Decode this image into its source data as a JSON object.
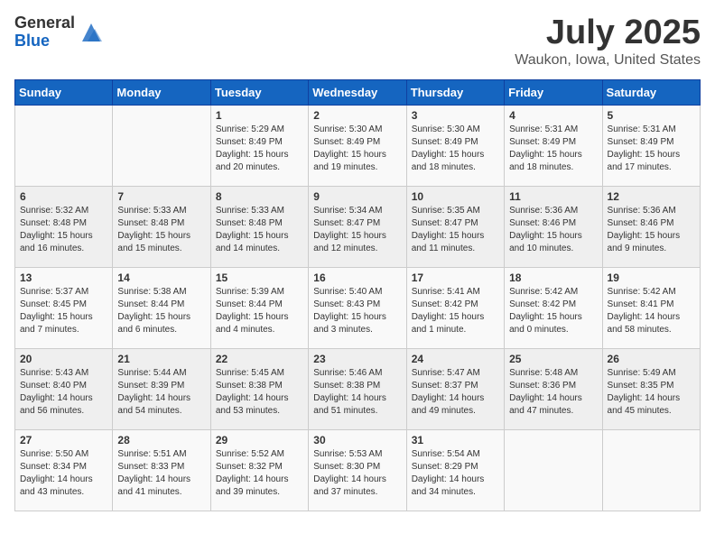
{
  "header": {
    "logo_general": "General",
    "logo_blue": "Blue",
    "month": "July 2025",
    "location": "Waukon, Iowa, United States"
  },
  "days_of_week": [
    "Sunday",
    "Monday",
    "Tuesday",
    "Wednesday",
    "Thursday",
    "Friday",
    "Saturday"
  ],
  "weeks": [
    [
      {
        "day": "",
        "content": ""
      },
      {
        "day": "",
        "content": ""
      },
      {
        "day": "1",
        "content": "Sunrise: 5:29 AM\nSunset: 8:49 PM\nDaylight: 15 hours and 20 minutes."
      },
      {
        "day": "2",
        "content": "Sunrise: 5:30 AM\nSunset: 8:49 PM\nDaylight: 15 hours and 19 minutes."
      },
      {
        "day": "3",
        "content": "Sunrise: 5:30 AM\nSunset: 8:49 PM\nDaylight: 15 hours and 18 minutes."
      },
      {
        "day": "4",
        "content": "Sunrise: 5:31 AM\nSunset: 8:49 PM\nDaylight: 15 hours and 18 minutes."
      },
      {
        "day": "5",
        "content": "Sunrise: 5:31 AM\nSunset: 8:49 PM\nDaylight: 15 hours and 17 minutes."
      }
    ],
    [
      {
        "day": "6",
        "content": "Sunrise: 5:32 AM\nSunset: 8:48 PM\nDaylight: 15 hours and 16 minutes."
      },
      {
        "day": "7",
        "content": "Sunrise: 5:33 AM\nSunset: 8:48 PM\nDaylight: 15 hours and 15 minutes."
      },
      {
        "day": "8",
        "content": "Sunrise: 5:33 AM\nSunset: 8:48 PM\nDaylight: 15 hours and 14 minutes."
      },
      {
        "day": "9",
        "content": "Sunrise: 5:34 AM\nSunset: 8:47 PM\nDaylight: 15 hours and 12 minutes."
      },
      {
        "day": "10",
        "content": "Sunrise: 5:35 AM\nSunset: 8:47 PM\nDaylight: 15 hours and 11 minutes."
      },
      {
        "day": "11",
        "content": "Sunrise: 5:36 AM\nSunset: 8:46 PM\nDaylight: 15 hours and 10 minutes."
      },
      {
        "day": "12",
        "content": "Sunrise: 5:36 AM\nSunset: 8:46 PM\nDaylight: 15 hours and 9 minutes."
      }
    ],
    [
      {
        "day": "13",
        "content": "Sunrise: 5:37 AM\nSunset: 8:45 PM\nDaylight: 15 hours and 7 minutes."
      },
      {
        "day": "14",
        "content": "Sunrise: 5:38 AM\nSunset: 8:44 PM\nDaylight: 15 hours and 6 minutes."
      },
      {
        "day": "15",
        "content": "Sunrise: 5:39 AM\nSunset: 8:44 PM\nDaylight: 15 hours and 4 minutes."
      },
      {
        "day": "16",
        "content": "Sunrise: 5:40 AM\nSunset: 8:43 PM\nDaylight: 15 hours and 3 minutes."
      },
      {
        "day": "17",
        "content": "Sunrise: 5:41 AM\nSunset: 8:42 PM\nDaylight: 15 hours and 1 minute."
      },
      {
        "day": "18",
        "content": "Sunrise: 5:42 AM\nSunset: 8:42 PM\nDaylight: 15 hours and 0 minutes."
      },
      {
        "day": "19",
        "content": "Sunrise: 5:42 AM\nSunset: 8:41 PM\nDaylight: 14 hours and 58 minutes."
      }
    ],
    [
      {
        "day": "20",
        "content": "Sunrise: 5:43 AM\nSunset: 8:40 PM\nDaylight: 14 hours and 56 minutes."
      },
      {
        "day": "21",
        "content": "Sunrise: 5:44 AM\nSunset: 8:39 PM\nDaylight: 14 hours and 54 minutes."
      },
      {
        "day": "22",
        "content": "Sunrise: 5:45 AM\nSunset: 8:38 PM\nDaylight: 14 hours and 53 minutes."
      },
      {
        "day": "23",
        "content": "Sunrise: 5:46 AM\nSunset: 8:38 PM\nDaylight: 14 hours and 51 minutes."
      },
      {
        "day": "24",
        "content": "Sunrise: 5:47 AM\nSunset: 8:37 PM\nDaylight: 14 hours and 49 minutes."
      },
      {
        "day": "25",
        "content": "Sunrise: 5:48 AM\nSunset: 8:36 PM\nDaylight: 14 hours and 47 minutes."
      },
      {
        "day": "26",
        "content": "Sunrise: 5:49 AM\nSunset: 8:35 PM\nDaylight: 14 hours and 45 minutes."
      }
    ],
    [
      {
        "day": "27",
        "content": "Sunrise: 5:50 AM\nSunset: 8:34 PM\nDaylight: 14 hours and 43 minutes."
      },
      {
        "day": "28",
        "content": "Sunrise: 5:51 AM\nSunset: 8:33 PM\nDaylight: 14 hours and 41 minutes."
      },
      {
        "day": "29",
        "content": "Sunrise: 5:52 AM\nSunset: 8:32 PM\nDaylight: 14 hours and 39 minutes."
      },
      {
        "day": "30",
        "content": "Sunrise: 5:53 AM\nSunset: 8:30 PM\nDaylight: 14 hours and 37 minutes."
      },
      {
        "day": "31",
        "content": "Sunrise: 5:54 AM\nSunset: 8:29 PM\nDaylight: 14 hours and 34 minutes."
      },
      {
        "day": "",
        "content": ""
      },
      {
        "day": "",
        "content": ""
      }
    ]
  ]
}
